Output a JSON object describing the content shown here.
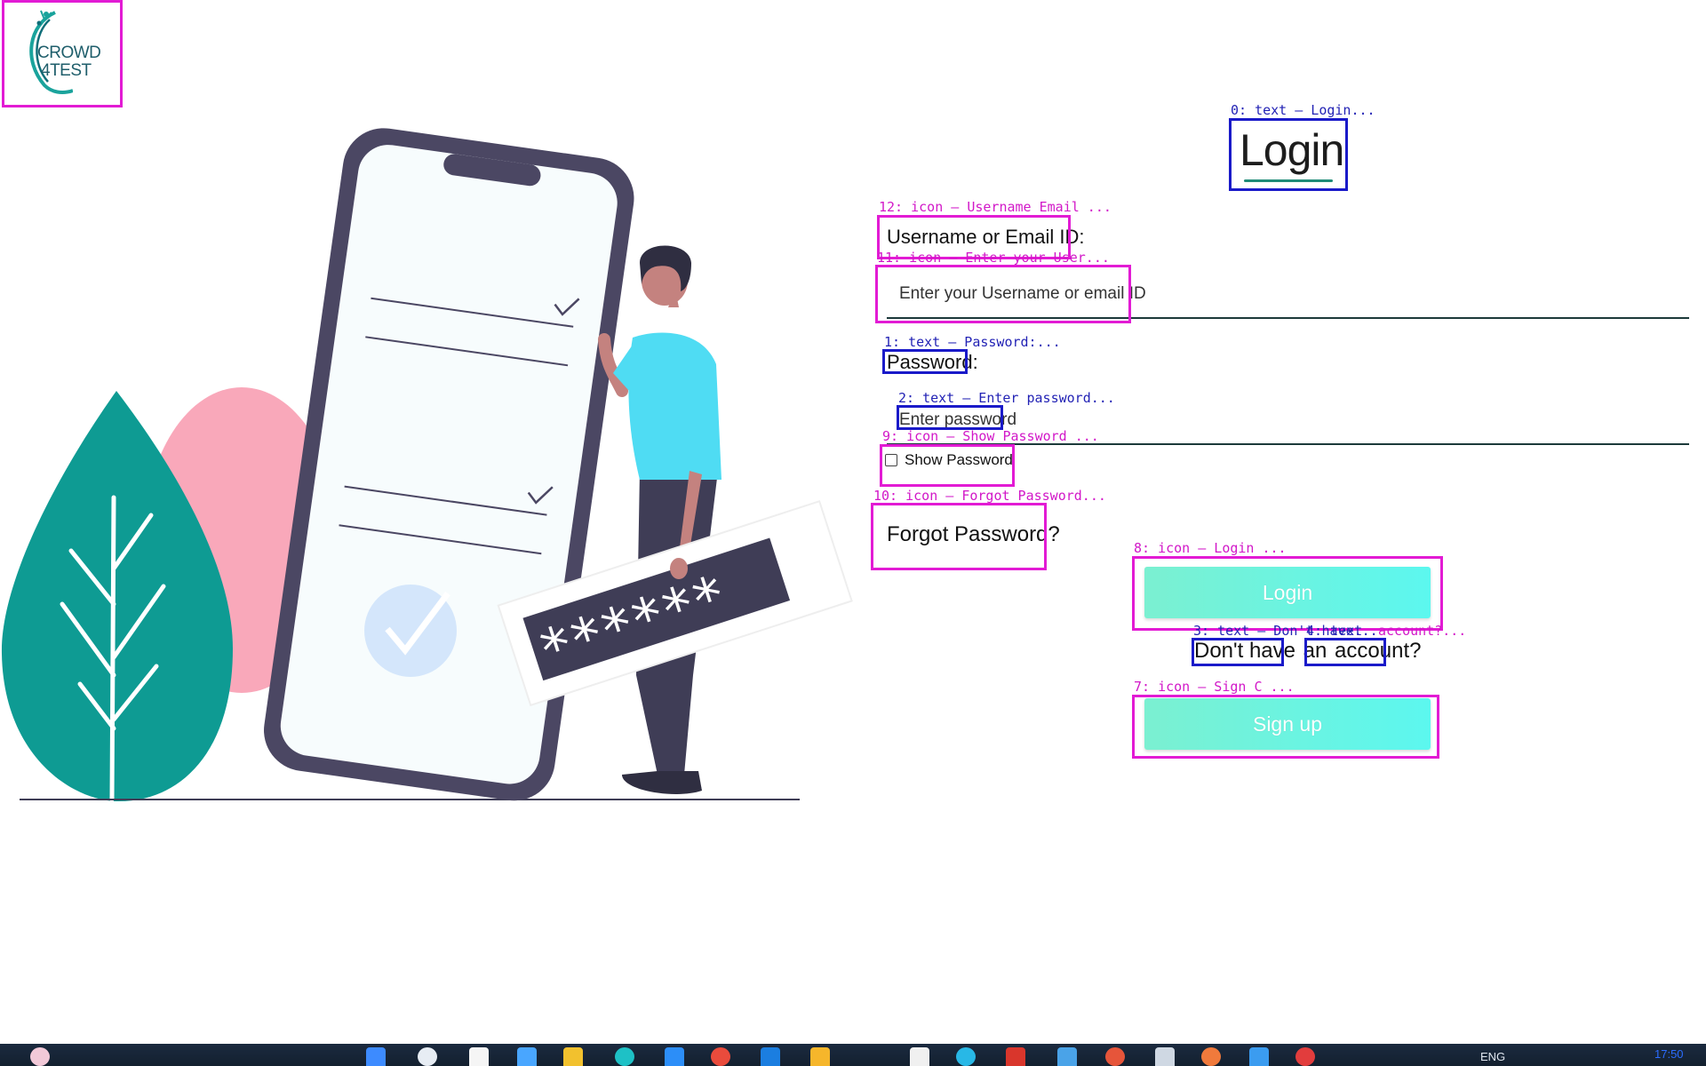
{
  "brand": {
    "logo_line1": "CROWD",
    "logo_line2": "4TEST"
  },
  "login": {
    "title": "Login",
    "username_label": "Username or Email ID:",
    "username_placeholder": "Enter your Username or email ID",
    "password_label": "Password:",
    "password_placeholder": "Enter password",
    "show_password_label": "Show Password",
    "forgot_password": "Forgot Password?",
    "login_button": "Login",
    "no_account_part1": "Don't have",
    "no_account_part2": "an",
    "no_account_part3": "account?",
    "signup_button": "Sign up"
  },
  "annotations": {
    "a0": "0: text — Login...",
    "a12": "12: icon — Username Email ...",
    "a11": "11: icon — Enter your User...",
    "a1": "1: text — Password:...",
    "a2": "2: text — Enter password...",
    "a9": "9: icon — Show Password ...",
    "a10": "10: icon — Forgot Password...",
    "a8": "8: icon — Login ...",
    "a3": "3: text — Don't have...",
    "a4": "4: text",
    "a5": "account?...",
    "a7": "7: icon — Sign C ..."
  },
  "illustration": {
    "password_mask": "******"
  },
  "taskbar": {
    "language": "ENG",
    "time": "17:50"
  },
  "colors": {
    "button_gradient_start": "#7bf0d1",
    "button_gradient_end": "#5cf7ef",
    "annotation_magenta": "#e21bd4",
    "annotation_blue": "#1a1ac9",
    "leaf_teal": "#0e9b93",
    "phone_frame": "#4b4763",
    "shirt_cyan": "#4fdcf3"
  }
}
